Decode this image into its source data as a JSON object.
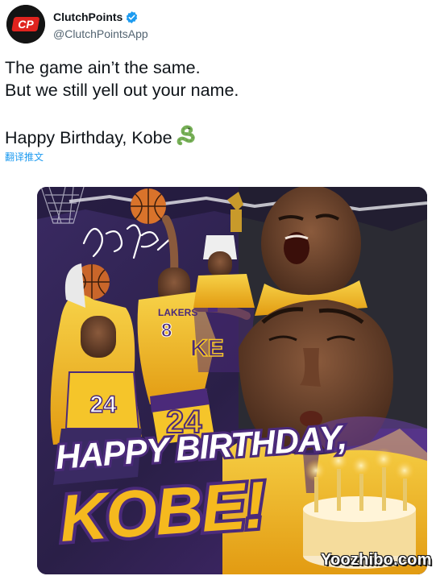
{
  "account": {
    "display_name": "ClutchPoints",
    "handle": "@ClutchPointsApp",
    "avatar_text": "CP",
    "verified": true,
    "brand_color": "#e0231e"
  },
  "tweet": {
    "lines": [
      "The game ain’t the same.",
      "But we still yell out your name.",
      "",
      "Happy Birthday, Kobe"
    ],
    "emoji": "snake-icon",
    "translate_label": "翻译推文"
  },
  "media": {
    "headline_1": "HAPPY BIRTHDAY,",
    "headline_2": "KOBE!",
    "jersey_number": "24",
    "jersey_number_2": "8",
    "team_text": "LAKERS",
    "signature": "Kobe Bryant",
    "colors": {
      "purple": "#4b2a7a",
      "gold": "#f5b91e",
      "white": "#ffffff"
    }
  },
  "watermark": "Yoozhibo.com"
}
